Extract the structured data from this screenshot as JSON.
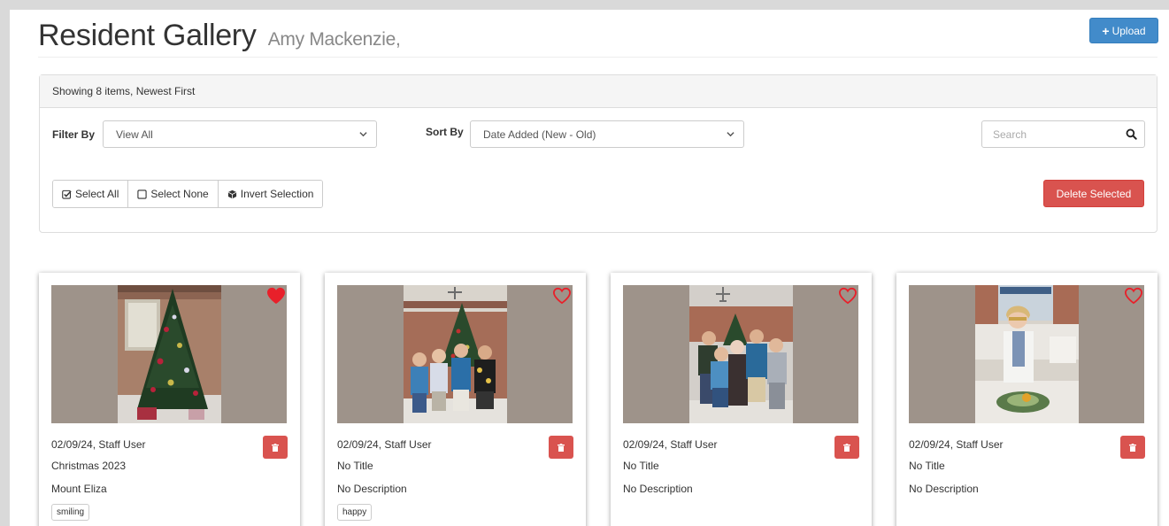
{
  "header": {
    "title": "Resident Gallery",
    "subtitle": "Amy Mackenzie,",
    "upload_label": "Upload"
  },
  "panel": {
    "heading": "Showing 8 items, Newest First",
    "filter_label": "Filter By",
    "filter_value": "View All",
    "sort_label": "Sort By",
    "sort_value": "Date Added (New - Old)",
    "search_placeholder": "Search",
    "select_all": "Select All",
    "select_none": "Select None",
    "invert_selection": "Invert Selection",
    "delete_selected": "Delete Selected"
  },
  "colors": {
    "primary": "#428bca",
    "danger": "#d9534f",
    "heart": "#e8202a"
  },
  "cards": [
    {
      "meta": "02/09/24, Staff User",
      "title": "Christmas 2023",
      "description": "Mount Eliza",
      "tag": "smiling",
      "favorite": true,
      "photo": "christmas-tree"
    },
    {
      "meta": "02/09/24, Staff User",
      "title": "No Title",
      "description": "No Description",
      "tag": "happy",
      "favorite": false,
      "photo": "boys-by-tree"
    },
    {
      "meta": "02/09/24, Staff User",
      "title": "No Title",
      "description": "No Description",
      "tag": "",
      "favorite": false,
      "photo": "family-group"
    },
    {
      "meta": "02/09/24, Staff User",
      "title": "No Title",
      "description": "No Description",
      "tag": "",
      "favorite": false,
      "photo": "woman-with-dish"
    }
  ]
}
